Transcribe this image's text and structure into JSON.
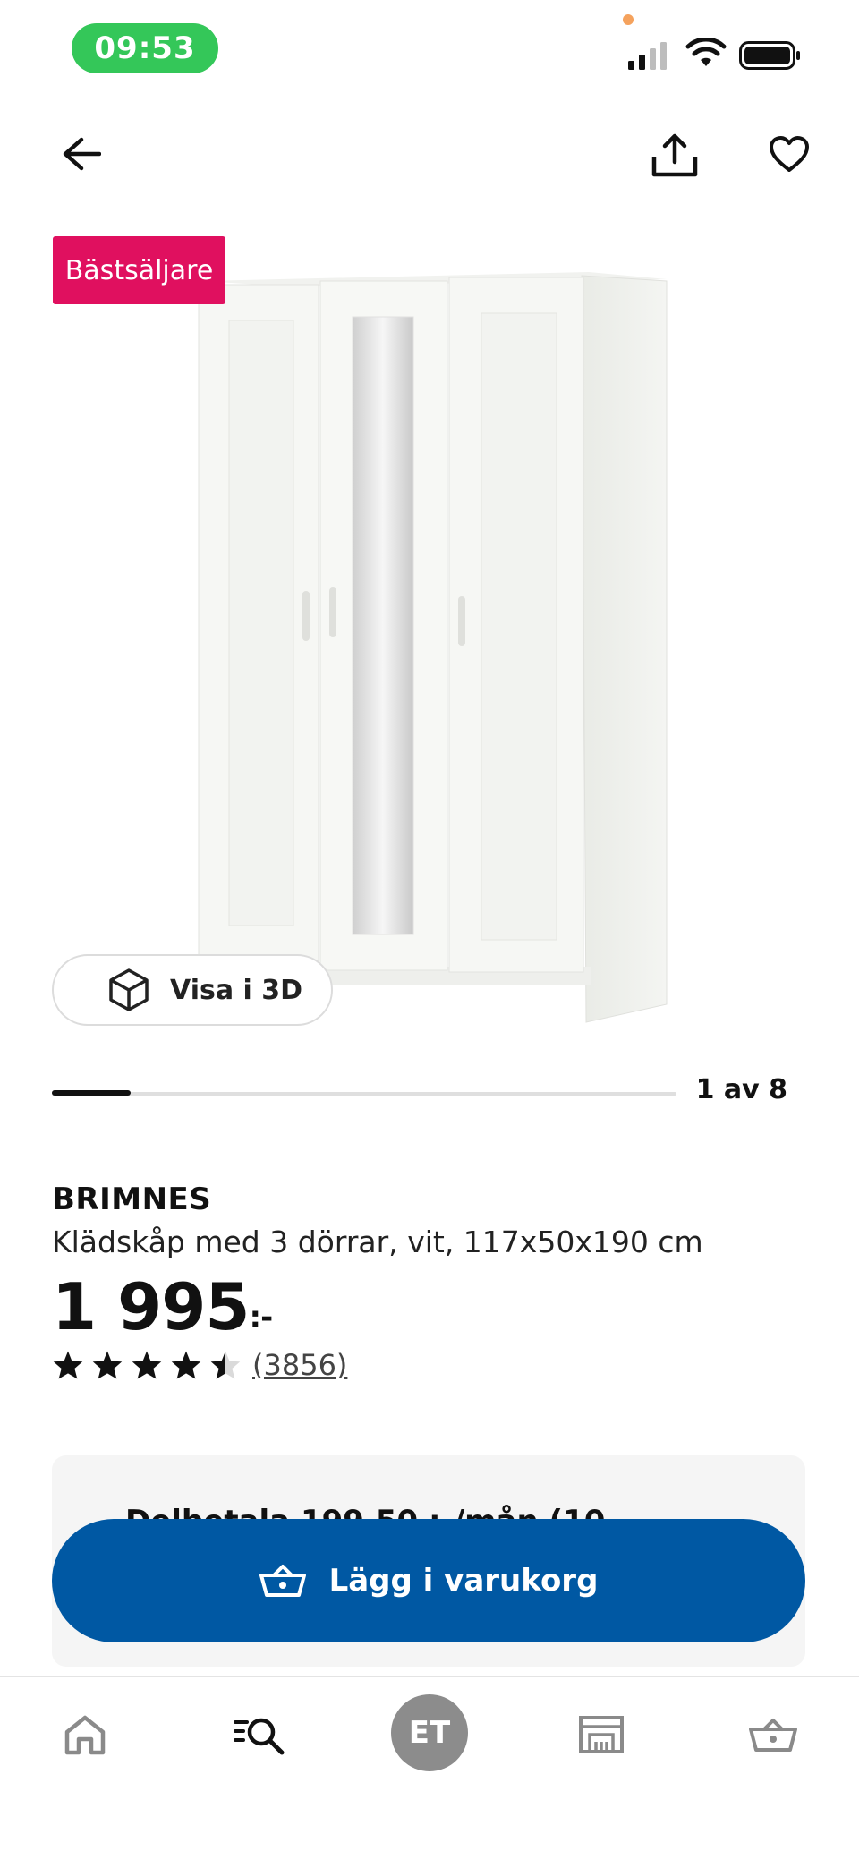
{
  "status_bar": {
    "time": "09:53"
  },
  "top_bar": {
    "back_icon": "arrow-left-icon",
    "share_icon": "share-icon",
    "favorite_icon": "heart-icon"
  },
  "product": {
    "badge": "Bästsäljare",
    "view_3d_label": "Visa i 3D",
    "image_position": "1 av 8",
    "brand": "BRIMNES",
    "description": "Klädskåp med 3 dörrar, vit, 117x50x190 cm",
    "price": "1 995",
    "price_suffix": ":-",
    "rating": 4.5,
    "rating_max": 5,
    "review_count": "(3856)"
  },
  "info_card": {
    "partial_text": "Delbetala 199,50 :-/mån (10"
  },
  "cart_button": {
    "label": "Lägg i varukorg",
    "icon": "basket-icon"
  },
  "bottom_nav": {
    "items": [
      {
        "name": "home",
        "icon": "home-icon"
      },
      {
        "name": "search",
        "icon": "search-icon"
      },
      {
        "name": "profile",
        "initials": "ET"
      },
      {
        "name": "store",
        "icon": "store-icon"
      },
      {
        "name": "cart",
        "icon": "basket-icon"
      }
    ]
  },
  "colors": {
    "badge": "#e0105f",
    "primary_button": "#0058a3",
    "time_pill": "#34c759"
  }
}
